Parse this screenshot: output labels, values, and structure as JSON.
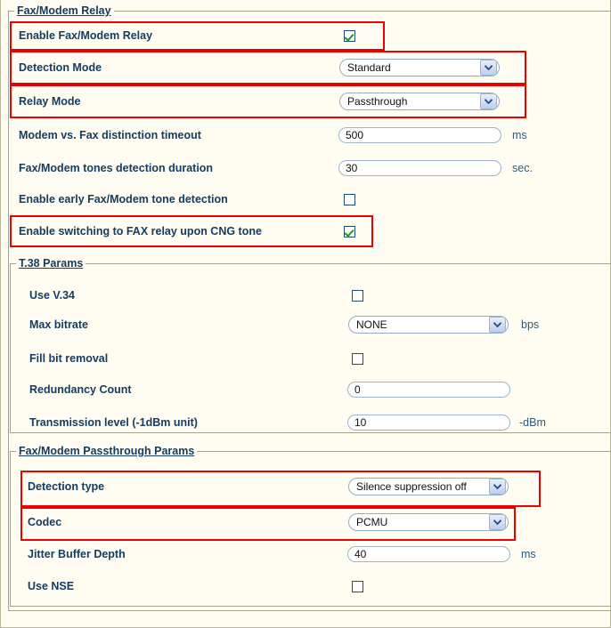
{
  "page": {
    "background": "#fffdf2",
    "label_color": "#153d62",
    "highlight_color": "#ee0000",
    "checked_color": "#1a9a1a"
  },
  "sections": {
    "relay": {
      "legend": "Fax/Modem Relay",
      "rows": {
        "enable_relay": {
          "label": "Enable Fax/Modem Relay",
          "checked": true,
          "control": "checkbox"
        },
        "detection_mode": {
          "label": "Detection Mode",
          "value": "Standard",
          "control": "select"
        },
        "relay_mode": {
          "label": "Relay Mode",
          "value": "Passthrough",
          "control": "select"
        },
        "modem_fax_timeout": {
          "label": "Modem vs. Fax distinction timeout",
          "value": "500",
          "unit": "ms",
          "control": "text"
        },
        "tones_duration": {
          "label": "Fax/Modem tones detection duration",
          "value": "30",
          "unit": "sec.",
          "control": "text"
        },
        "early_tone": {
          "label": "Enable early Fax/Modem tone detection",
          "checked": false,
          "control": "checkbox"
        },
        "cng_switch": {
          "label": "Enable switching to FAX relay upon CNG tone",
          "checked": true,
          "control": "checkbox"
        }
      }
    },
    "t38": {
      "legend": "T.38 Params",
      "rows": {
        "use_v34": {
          "label": "Use V.34",
          "checked": false,
          "control": "checkbox"
        },
        "max_bitrate": {
          "label": "Max bitrate",
          "value": "NONE",
          "unit": "bps",
          "control": "select"
        },
        "fill_bit_removal": {
          "label": "Fill bit removal",
          "checked": false,
          "control": "checkbox"
        },
        "redundancy_count": {
          "label": "Redundancy Count",
          "value": "0",
          "unit": "",
          "control": "text"
        },
        "transmission_level": {
          "label": "Transmission level (-1dBm unit)",
          "value": "10",
          "unit": "-dBm",
          "control": "text"
        }
      }
    },
    "passthrough": {
      "legend": "Fax/Modem Passthrough Params",
      "rows": {
        "detection_type": {
          "label": "Detection type",
          "value": "Silence suppression off",
          "control": "select"
        },
        "codec": {
          "label": "Codec",
          "value": "PCMU",
          "control": "select"
        },
        "jitter_buffer": {
          "label": "Jitter Buffer Depth",
          "value": "40",
          "unit": "ms",
          "control": "text"
        },
        "use_nse": {
          "label": "Use NSE",
          "checked": false,
          "control": "checkbox"
        }
      }
    }
  },
  "icons": {
    "dropdown_arrow": "chevron-down-icon",
    "checkmark": "check-icon"
  }
}
